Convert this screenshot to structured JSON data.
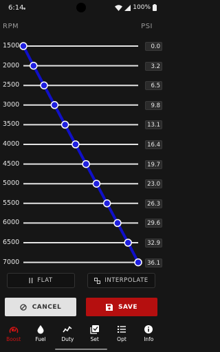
{
  "status_bar": {
    "time": "6:14",
    "battery_percent": "100%"
  },
  "table": {
    "rpm_header": "RPM",
    "psi_header": "PSI",
    "rows": [
      {
        "rpm": "1500",
        "psi": "0.0",
        "level": 0.0
      },
      {
        "rpm": "2000",
        "psi": "3.2",
        "level": 0.0886
      },
      {
        "rpm": "2500",
        "psi": "6.5",
        "level": 0.18
      },
      {
        "rpm": "3000",
        "psi": "9.8",
        "level": 0.2715
      },
      {
        "rpm": "3500",
        "psi": "13.1",
        "level": 0.363
      },
      {
        "rpm": "4000",
        "psi": "16.4",
        "level": 0.4543
      },
      {
        "rpm": "4500",
        "psi": "19.7",
        "level": 0.5457
      },
      {
        "rpm": "5000",
        "psi": "23.0",
        "level": 0.637
      },
      {
        "rpm": "5500",
        "psi": "26.3",
        "level": 0.7285
      },
      {
        "rpm": "6000",
        "psi": "29.6",
        "level": 0.82
      },
      {
        "rpm": "6500",
        "psi": "32.9",
        "level": 0.9114
      },
      {
        "rpm": "7000",
        "psi": "36.1",
        "level": 1.0
      }
    ]
  },
  "buttons": {
    "flat": "FLAT",
    "interpolate": "INTERPOLATE",
    "cancel": "CANCEL",
    "save": "SAVE"
  },
  "nav": {
    "active": "Boost",
    "items": [
      {
        "label": "Boost",
        "icon": "boost-icon"
      },
      {
        "label": "Fuel",
        "icon": "fuel-drop-icon"
      },
      {
        "label": "Duty",
        "icon": "duty-chart-icon"
      },
      {
        "label": "Set",
        "icon": "set-checkbox-icon"
      },
      {
        "label": "Opt",
        "icon": "options-list-icon"
      },
      {
        "label": "Info",
        "icon": "info-icon"
      }
    ]
  },
  "colors": {
    "accent_line": "#1010c8",
    "handle_fill": "#2020e0",
    "save_red": "#b50f0f",
    "active_nav": "#d21414"
  }
}
